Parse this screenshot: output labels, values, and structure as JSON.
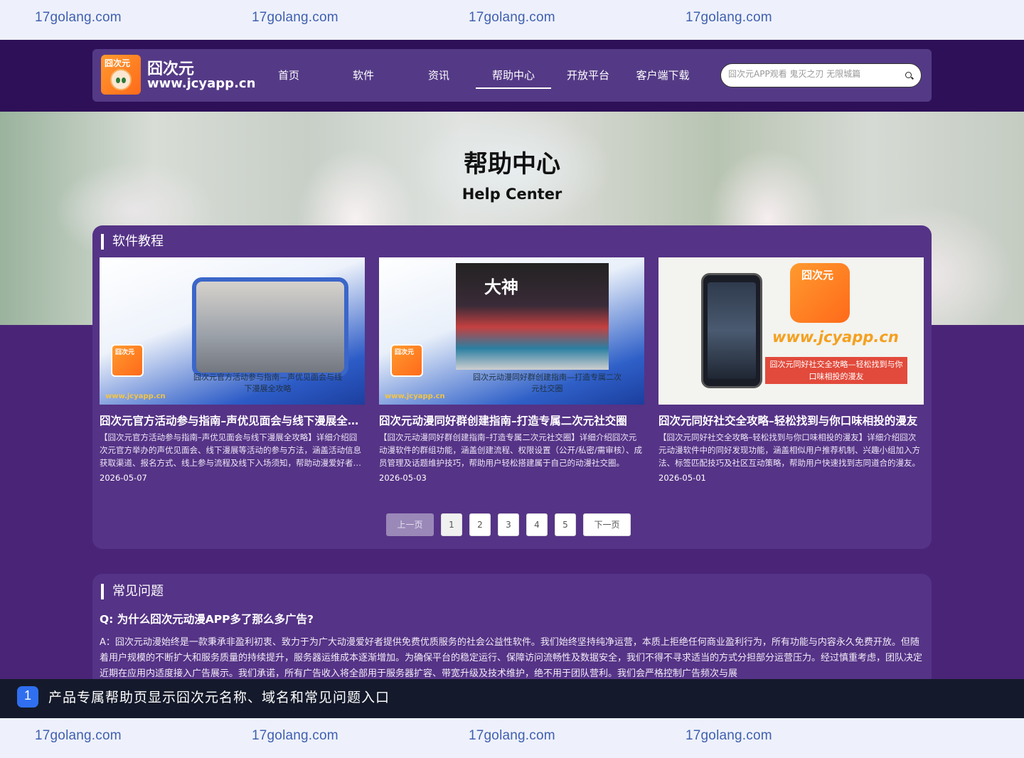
{
  "watermark": {
    "text": "17golang.com"
  },
  "header": {
    "logo_name": "囧次元",
    "logo_domain": "www.jcyapp.cn",
    "logo_tag": "囧次元",
    "nav": [
      {
        "label": "首页"
      },
      {
        "label": "软件"
      },
      {
        "label": "资讯"
      },
      {
        "label": "帮助中心",
        "active": true
      },
      {
        "label": "开放平台"
      },
      {
        "label": "客户端下载"
      }
    ],
    "search_placeholder": "囧次元APP观看 鬼灭之刃 无限城篇"
  },
  "banner": {
    "title": "帮助中心",
    "subtitle": "Help Center"
  },
  "tutorials": {
    "section_title": "软件教程",
    "cards": [
      {
        "image_caption": "囧次元官方活动参与指南—声优见面会与线下漫展全攻略",
        "image_url": "www.jcyapp.cn",
        "title": "囧次元官方活动参与指南–声优见面会与线下漫展全攻略",
        "desc": "【囧次元官方活动参与指南–声优见面会与线下漫展全攻略】详细介绍囧次元官方举办的声优见面会、线下漫展等活动的参与方法，涵盖活动信息获取渠道、报名方式、线上参与流程及线下入场须知，帮助动漫爱好者顺利参与各类官方活动。",
        "date": "2026-05-07"
      },
      {
        "image_caption": "囧次元动漫同好群创建指南—打造专属二次元社交圈",
        "image_url": "www.jcyapp.cn",
        "image_sign": "大神",
        "title": "囧次元动漫同好群创建指南–打造专属二次元社交圈",
        "desc": "【囧次元动漫同好群创建指南–打造专属二次元社交圈】详细介绍囧次元动漫软件的群组功能，涵盖创建流程、权限设置（公开/私密/需审核）、成员管理及话题维护技巧，帮助用户轻松搭建属于自己的动漫社交圈。",
        "date": "2026-05-03"
      },
      {
        "image_caption": "囧次元同好社交全攻略—轻松找到与你口味相投的漫友",
        "image_url": "www.jcyapp.cn",
        "title": "囧次元同好社交全攻略–轻松找到与你口味相投的漫友",
        "desc": "【囧次元同好社交全攻略–轻松找到与你口味相投的漫友】详细介绍囧次元动漫软件中的同好发现功能，涵盖相似用户推荐机制、兴趣小组加入方法、标签匹配技巧及社区互动策略，帮助用户快速找到志同道合的漫友。",
        "date": "2026-05-01"
      }
    ],
    "pager": {
      "prev": "上一页",
      "pages": [
        "1",
        "2",
        "3",
        "4",
        "5"
      ],
      "next": "下一页"
    }
  },
  "faq": {
    "section_title": "常见问题",
    "question": "Q:  为什么囧次元动漫APP多了那么多广告?",
    "answer": "A：囧次元动漫始终是一款秉承非盈利初衷、致力于为广大动漫爱好者提供免费优质服务的社会公益性软件。我们始终坚持纯净运营，本质上拒绝任何商业盈利行为，所有功能与内容永久免费开放。但随着用户规模的不断扩大和服务质量的持续提升，服务器运维成本逐渐增加。为确保平台的稳定运行、保障访问流畅性及数据安全，我们不得不寻求适当的方式分担部分运营压力。经过慎重考虑，团队决定近期在应用内适度接入广告展示。我们承诺，所有广告收入将全部用于服务器扩容、带宽升级及技术维护，绝不用于团队营利。我们会严格控制广告频次与展"
  },
  "annotation": {
    "number": "1",
    "text": "产品专属帮助页显示囧次元名称、域名和常见问题入口"
  }
}
